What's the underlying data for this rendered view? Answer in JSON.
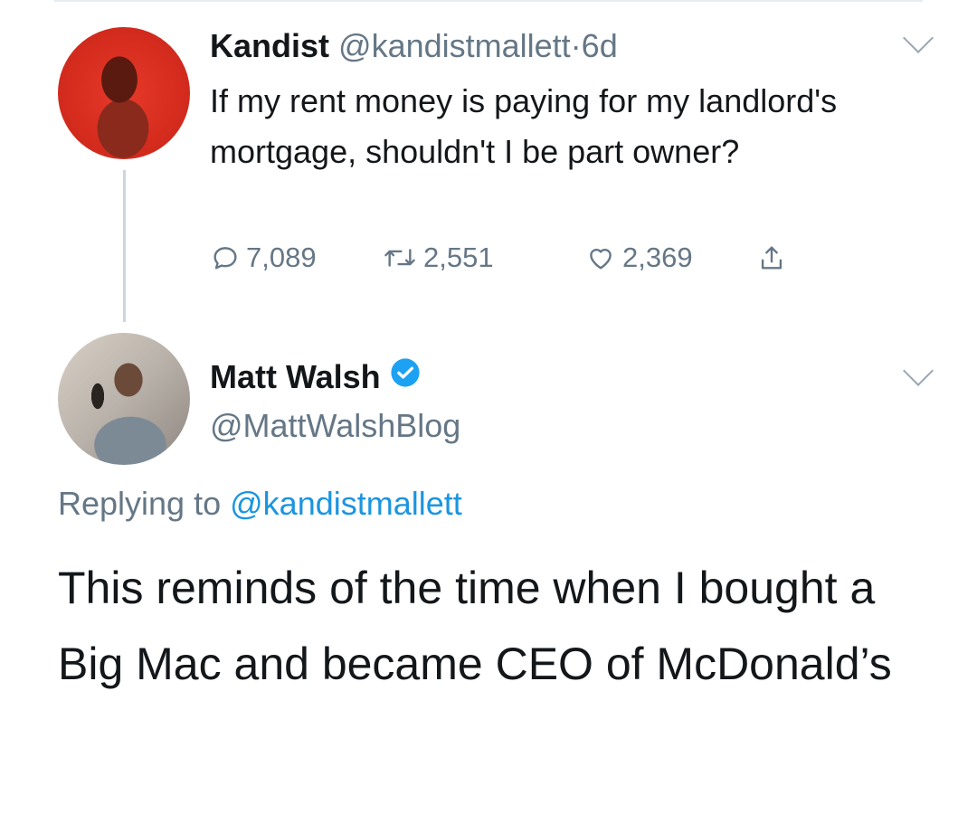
{
  "tweet1": {
    "name": "Kandist",
    "handle": "@kandistmallett",
    "separator": "·",
    "age": "6d",
    "text": "If my rent money is paying for my landlord's mortgage, shouldn't I be part owner?",
    "replies": "7,089",
    "retweets": "2,551",
    "likes": "2,369"
  },
  "tweet2": {
    "name": "Matt Walsh",
    "handle": "@MattWalshBlog",
    "replying_prefix": "Replying to",
    "replying_handle": "@kandistmallett",
    "text": "This reminds of the time when I bought a Big Mac and became CEO of McDonald’s"
  },
  "colors": {
    "text": "#14171a",
    "muted": "#657786",
    "link": "#1b95e0",
    "verified": "#1da1f2",
    "kandist_avatar": "#d52c1e"
  },
  "icons": [
    "reply-icon",
    "retweet-icon",
    "like-icon",
    "share-icon",
    "verified-badge-icon",
    "chevron-down-icon"
  ]
}
